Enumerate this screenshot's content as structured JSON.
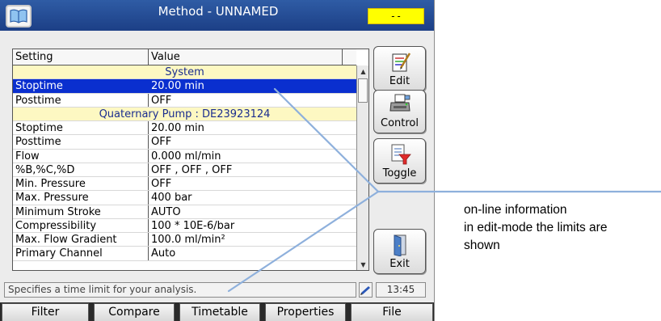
{
  "window": {
    "title": "Method - UNNAMED",
    "badge": "--",
    "icon": "book-icon"
  },
  "table": {
    "headers": [
      "Setting",
      "Value"
    ],
    "rows": [
      {
        "type": "group",
        "label": "System"
      },
      {
        "type": "item",
        "setting": "Stoptime",
        "value": "20.00 min",
        "selected": true
      },
      {
        "type": "item",
        "setting": "Posttime",
        "value": "OFF"
      },
      {
        "type": "group",
        "label": "Quaternary Pump : DE23923124"
      },
      {
        "type": "item",
        "setting": "Stoptime",
        "value": "20.00 min"
      },
      {
        "type": "item",
        "setting": "Posttime",
        "value": "OFF"
      },
      {
        "type": "item",
        "setting": "Flow",
        "value": "0.000 ml/min"
      },
      {
        "type": "item",
        "setting": "%B,%C,%D",
        "value": "OFF , OFF , OFF"
      },
      {
        "type": "item",
        "setting": "Min. Pressure",
        "value": "OFF"
      },
      {
        "type": "item",
        "setting": "Max. Pressure",
        "value": "400 bar"
      },
      {
        "type": "item",
        "setting": "Minimum Stroke",
        "value": "AUTO"
      },
      {
        "type": "item",
        "setting": "Compressibility",
        "value": "100 * 10E-6/bar"
      },
      {
        "type": "item",
        "setting": "Max. Flow Gradient",
        "value": "100.0 ml/min²"
      },
      {
        "type": "item",
        "setting": "Primary Channel",
        "value": "Auto"
      }
    ]
  },
  "side_buttons": [
    {
      "label": "Edit",
      "icon": "edit-icon"
    },
    {
      "label": "Control",
      "icon": "printer-icon"
    },
    {
      "label": "Toggle",
      "icon": "filter-toggle-icon"
    },
    {
      "label": "Exit",
      "icon": "exit-door-icon"
    }
  ],
  "status": {
    "message": "Specifies a time limit for your analysis.",
    "time": "13:45",
    "icon": "pen-icon"
  },
  "tabs": [
    "Filter",
    "Compare",
    "Timetable",
    "Properties",
    "File"
  ],
  "annotation": {
    "lines": [
      "on-line information",
      "in edit-mode the limits are",
      "shown"
    ],
    "line_color": "#8eb0dc"
  },
  "colors": {
    "titlebar": "#1c3f86",
    "selection": "#0a2fcf",
    "group_row": "#fdf8c2",
    "badge": "#ffff00"
  }
}
